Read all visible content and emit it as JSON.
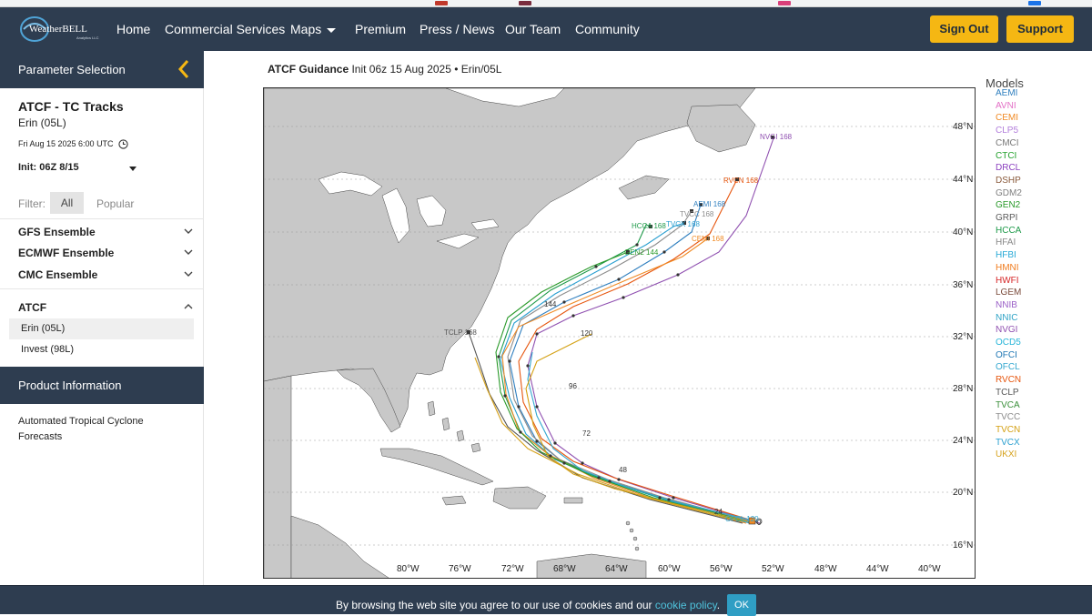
{
  "nav": {
    "brand_name": "WeatherBELL",
    "brand_sub": "Analytics LLC",
    "items": [
      "Home",
      "Commercial Services",
      "Maps",
      "Premium",
      "Press / News",
      "Our Team",
      "Community"
    ],
    "sign_out": "Sign Out",
    "support": "Support"
  },
  "sidebar": {
    "param_header": "Parameter Selection",
    "product_title": "ATCF - TC Tracks",
    "storm": "Erin (05L)",
    "datetime": "Fri Aug 15 2025 6:00 UTC",
    "init": "Init: 06Z 8/15",
    "filter_label": "Filter:",
    "filter_all": "All",
    "filter_popular": "Popular",
    "groups": [
      "GFS Ensemble",
      "ECMWF Ensemble",
      "CMC Ensemble",
      "ATCF"
    ],
    "atcf_items": [
      "Erin (05L)",
      "Invest (98L)"
    ],
    "product_info_header": "Product Information",
    "product_info_text": [
      "Automated Tropical Cyclone",
      "Forecasts"
    ]
  },
  "chart": {
    "title_bold": "ATCF Guidance",
    "title_rest": "Init 06z 15 Aug 2025 • Erin/05L",
    "lat_labels": [
      "48°N",
      "44°N",
      "40°N",
      "36°N",
      "32°N",
      "28°N",
      "24°N",
      "20°N",
      "16°N"
    ],
    "lon_labels": [
      "80°W",
      "76°W",
      "72°W",
      "68°W",
      "64°W",
      "60°W",
      "56°W",
      "52°W",
      "48°W",
      "44°W",
      "40°W"
    ],
    "track_end_labels": [
      "NVGI 168",
      "RVCN 168",
      "AEMI 168",
      "TVCC 168",
      "TVCX 168",
      "HCCA 168",
      "CEMI 168",
      "GEN2 144",
      "TCLP 168",
      "OFCL 120"
    ],
    "hour_labels": [
      "144",
      "120",
      "96",
      "72",
      "48",
      "24",
      "0"
    ]
  },
  "models": {
    "header": "Models",
    "items": [
      {
        "name": "AEMI",
        "color": "#2f7fbf"
      },
      {
        "name": "AVNI",
        "color": "#e36fc6"
      },
      {
        "name": "CEMI",
        "color": "#f08a24"
      },
      {
        "name": "CLP5",
        "color": "#b27ddb"
      },
      {
        "name": "CMCI",
        "color": "#777777"
      },
      {
        "name": "CTCI",
        "color": "#23a12d"
      },
      {
        "name": "DRCL",
        "color": "#8b3fbf"
      },
      {
        "name": "DSHP",
        "color": "#8a5a3c"
      },
      {
        "name": "GDM2",
        "color": "#7f7f7f"
      },
      {
        "name": "GEN2",
        "color": "#2a9a2a"
      },
      {
        "name": "GRPI",
        "color": "#5a5a5a"
      },
      {
        "name": "HCCA",
        "color": "#1f9a4a"
      },
      {
        "name": "HFAI",
        "color": "#888888"
      },
      {
        "name": "HFBI",
        "color": "#27a9d6"
      },
      {
        "name": "HMNI",
        "color": "#f07c1e"
      },
      {
        "name": "HWFI",
        "color": "#d62728"
      },
      {
        "name": "LGEM",
        "color": "#7a4a3a"
      },
      {
        "name": "NNIB",
        "color": "#9a5fc7"
      },
      {
        "name": "NNIC",
        "color": "#2fa3c6"
      },
      {
        "name": "NVGI",
        "color": "#8f4fb0"
      },
      {
        "name": "OCD5",
        "color": "#27b5d8"
      },
      {
        "name": "OFCI",
        "color": "#1f77b4"
      },
      {
        "name": "OFCL",
        "color": "#34a8d0"
      },
      {
        "name": "RVCN",
        "color": "#e6550d"
      },
      {
        "name": "TCLP",
        "color": "#555555"
      },
      {
        "name": "TVCA",
        "color": "#3a8f3a"
      },
      {
        "name": "TVCC",
        "color": "#8c8c8c"
      },
      {
        "name": "TVCN",
        "color": "#d4a012"
      },
      {
        "name": "TVCX",
        "color": "#2a9fd0"
      },
      {
        "name": "UKXI",
        "color": "#d6a21c"
      }
    ]
  },
  "cookie": {
    "text": "By browsing the web site you agree to our use of cookies and our",
    "link": "cookie policy",
    "period": ".",
    "ok": "OK"
  },
  "colors": {
    "nav_bg": "#2e3d50",
    "accent_yellow": "#f5b713",
    "land": "#c8c8c8",
    "ocean": "#ffffff"
  }
}
